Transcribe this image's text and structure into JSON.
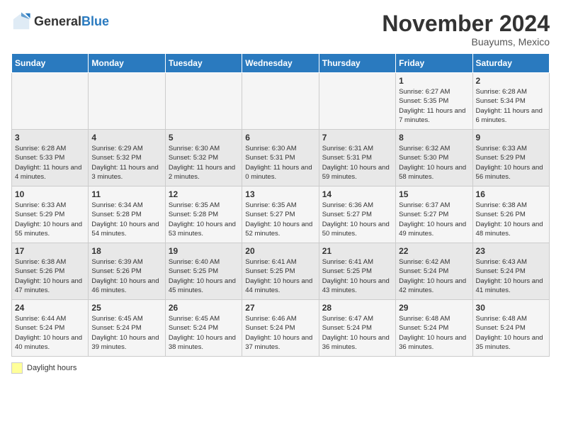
{
  "header": {
    "logo_general": "General",
    "logo_blue": "Blue",
    "month_year": "November 2024",
    "location": "Buayums, Mexico"
  },
  "weekdays": [
    "Sunday",
    "Monday",
    "Tuesday",
    "Wednesday",
    "Thursday",
    "Friday",
    "Saturday"
  ],
  "weeks": [
    [
      {
        "day": "",
        "info": ""
      },
      {
        "day": "",
        "info": ""
      },
      {
        "day": "",
        "info": ""
      },
      {
        "day": "",
        "info": ""
      },
      {
        "day": "",
        "info": ""
      },
      {
        "day": "1",
        "info": "Sunrise: 6:27 AM\nSunset: 5:35 PM\nDaylight: 11 hours and 7 minutes."
      },
      {
        "day": "2",
        "info": "Sunrise: 6:28 AM\nSunset: 5:34 PM\nDaylight: 11 hours and 6 minutes."
      }
    ],
    [
      {
        "day": "3",
        "info": "Sunrise: 6:28 AM\nSunset: 5:33 PM\nDaylight: 11 hours and 4 minutes."
      },
      {
        "day": "4",
        "info": "Sunrise: 6:29 AM\nSunset: 5:32 PM\nDaylight: 11 hours and 3 minutes."
      },
      {
        "day": "5",
        "info": "Sunrise: 6:30 AM\nSunset: 5:32 PM\nDaylight: 11 hours and 2 minutes."
      },
      {
        "day": "6",
        "info": "Sunrise: 6:30 AM\nSunset: 5:31 PM\nDaylight: 11 hours and 0 minutes."
      },
      {
        "day": "7",
        "info": "Sunrise: 6:31 AM\nSunset: 5:31 PM\nDaylight: 10 hours and 59 minutes."
      },
      {
        "day": "8",
        "info": "Sunrise: 6:32 AM\nSunset: 5:30 PM\nDaylight: 10 hours and 58 minutes."
      },
      {
        "day": "9",
        "info": "Sunrise: 6:33 AM\nSunset: 5:29 PM\nDaylight: 10 hours and 56 minutes."
      }
    ],
    [
      {
        "day": "10",
        "info": "Sunrise: 6:33 AM\nSunset: 5:29 PM\nDaylight: 10 hours and 55 minutes."
      },
      {
        "day": "11",
        "info": "Sunrise: 6:34 AM\nSunset: 5:28 PM\nDaylight: 10 hours and 54 minutes."
      },
      {
        "day": "12",
        "info": "Sunrise: 6:35 AM\nSunset: 5:28 PM\nDaylight: 10 hours and 53 minutes."
      },
      {
        "day": "13",
        "info": "Sunrise: 6:35 AM\nSunset: 5:27 PM\nDaylight: 10 hours and 52 minutes."
      },
      {
        "day": "14",
        "info": "Sunrise: 6:36 AM\nSunset: 5:27 PM\nDaylight: 10 hours and 50 minutes."
      },
      {
        "day": "15",
        "info": "Sunrise: 6:37 AM\nSunset: 5:27 PM\nDaylight: 10 hours and 49 minutes."
      },
      {
        "day": "16",
        "info": "Sunrise: 6:38 AM\nSunset: 5:26 PM\nDaylight: 10 hours and 48 minutes."
      }
    ],
    [
      {
        "day": "17",
        "info": "Sunrise: 6:38 AM\nSunset: 5:26 PM\nDaylight: 10 hours and 47 minutes."
      },
      {
        "day": "18",
        "info": "Sunrise: 6:39 AM\nSunset: 5:26 PM\nDaylight: 10 hours and 46 minutes."
      },
      {
        "day": "19",
        "info": "Sunrise: 6:40 AM\nSunset: 5:25 PM\nDaylight: 10 hours and 45 minutes."
      },
      {
        "day": "20",
        "info": "Sunrise: 6:41 AM\nSunset: 5:25 PM\nDaylight: 10 hours and 44 minutes."
      },
      {
        "day": "21",
        "info": "Sunrise: 6:41 AM\nSunset: 5:25 PM\nDaylight: 10 hours and 43 minutes."
      },
      {
        "day": "22",
        "info": "Sunrise: 6:42 AM\nSunset: 5:24 PM\nDaylight: 10 hours and 42 minutes."
      },
      {
        "day": "23",
        "info": "Sunrise: 6:43 AM\nSunset: 5:24 PM\nDaylight: 10 hours and 41 minutes."
      }
    ],
    [
      {
        "day": "24",
        "info": "Sunrise: 6:44 AM\nSunset: 5:24 PM\nDaylight: 10 hours and 40 minutes."
      },
      {
        "day": "25",
        "info": "Sunrise: 6:45 AM\nSunset: 5:24 PM\nDaylight: 10 hours and 39 minutes."
      },
      {
        "day": "26",
        "info": "Sunrise: 6:45 AM\nSunset: 5:24 PM\nDaylight: 10 hours and 38 minutes."
      },
      {
        "day": "27",
        "info": "Sunrise: 6:46 AM\nSunset: 5:24 PM\nDaylight: 10 hours and 37 minutes."
      },
      {
        "day": "28",
        "info": "Sunrise: 6:47 AM\nSunset: 5:24 PM\nDaylight: 10 hours and 36 minutes."
      },
      {
        "day": "29",
        "info": "Sunrise: 6:48 AM\nSunset: 5:24 PM\nDaylight: 10 hours and 36 minutes."
      },
      {
        "day": "30",
        "info": "Sunrise: 6:48 AM\nSunset: 5:24 PM\nDaylight: 10 hours and 35 minutes."
      }
    ]
  ],
  "legend": {
    "box_color": "#ffff99",
    "label": "Daylight hours"
  }
}
